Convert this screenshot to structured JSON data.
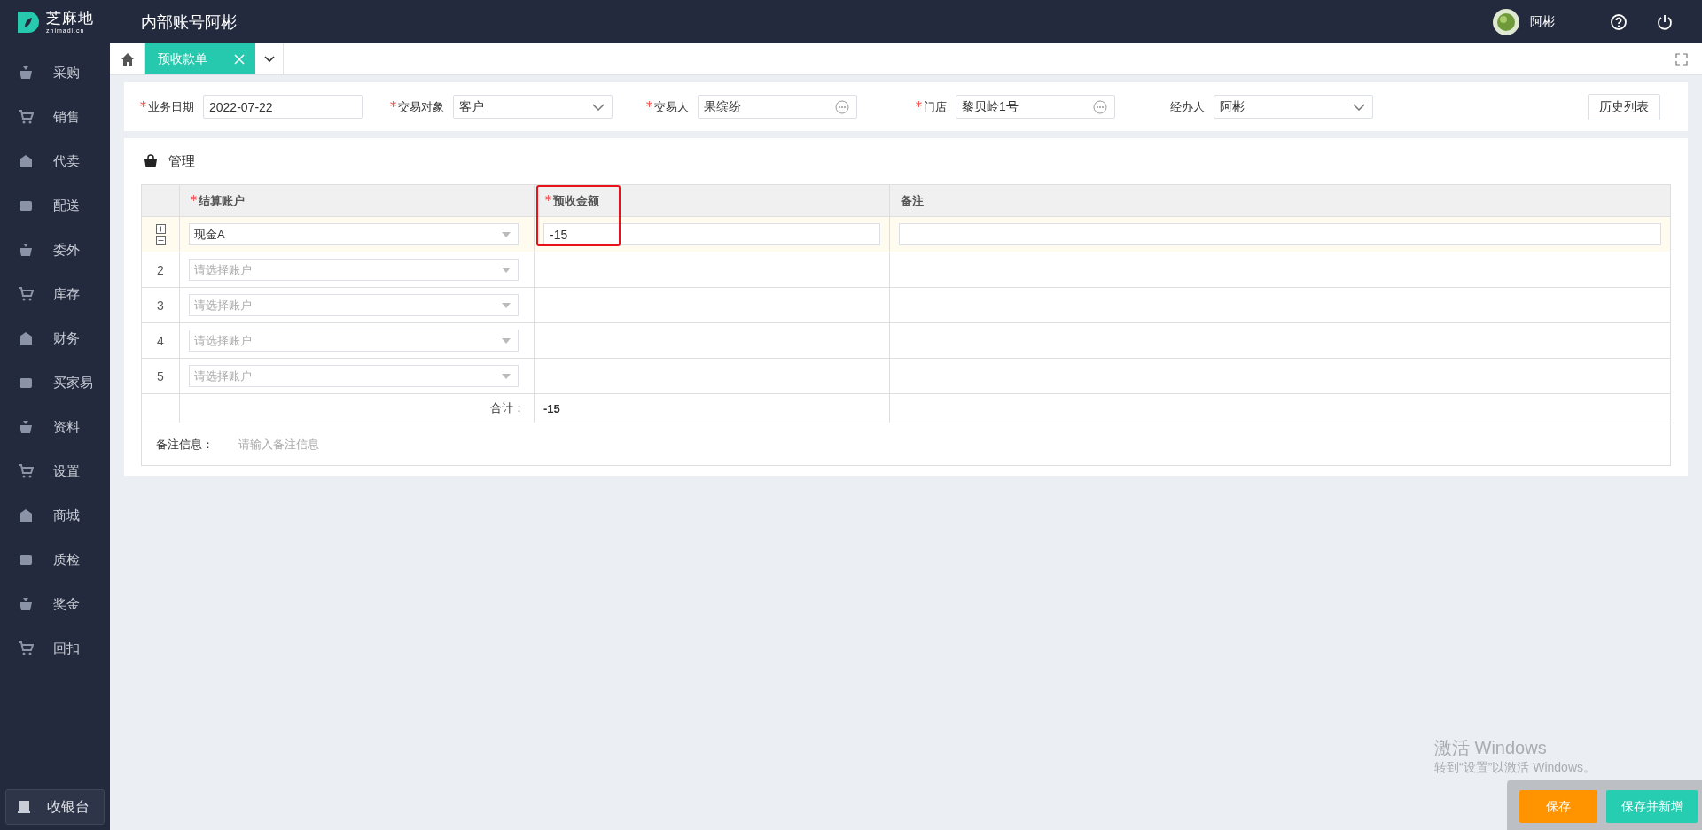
{
  "header": {
    "logo_text": "芝麻地",
    "logo_subtext": "zhimadi.cn",
    "account_title": "内部账号阿彬",
    "user_name": "阿彬"
  },
  "sidebar": {
    "items": [
      {
        "label": "采购"
      },
      {
        "label": "销售"
      },
      {
        "label": "代卖"
      },
      {
        "label": "配送"
      },
      {
        "label": "委外"
      },
      {
        "label": "库存"
      },
      {
        "label": "财务"
      },
      {
        "label": "买家易"
      },
      {
        "label": "资料"
      },
      {
        "label": "设置"
      },
      {
        "label": "商城"
      },
      {
        "label": "质检"
      },
      {
        "label": "奖金"
      },
      {
        "label": "回扣"
      }
    ],
    "cashier_button": "收银台"
  },
  "tabs": [
    {
      "label": "预收款单",
      "selected": true
    }
  ],
  "form": {
    "fields": [
      {
        "label": "业务日期",
        "required": true,
        "value": "2022-07-22",
        "kind": "text"
      },
      {
        "label": "交易对象",
        "required": true,
        "value": "客户",
        "kind": "select"
      },
      {
        "label": "交易人",
        "required": true,
        "value": "果缤纷",
        "kind": "picker"
      },
      {
        "label": "门店",
        "required": true,
        "value": "黎贝岭1号",
        "kind": "picker"
      },
      {
        "label": "经办人",
        "required": false,
        "value": "阿彬",
        "kind": "select"
      }
    ],
    "history_button": "历史列表"
  },
  "section": {
    "title": "管理"
  },
  "table": {
    "columns": [
      {
        "label": "结算账户",
        "required": true,
        "highlighted": false
      },
      {
        "label": "预收金额",
        "required": true,
        "highlighted": true
      },
      {
        "label": "备注",
        "required": false,
        "highlighted": false
      }
    ],
    "rows": [
      {
        "active": true,
        "account": "现金A",
        "amount": "-15"
      },
      {
        "active": false,
        "index": "2",
        "account_placeholder": "请选择账户"
      },
      {
        "active": false,
        "index": "3",
        "account_placeholder": "请选择账户"
      },
      {
        "active": false,
        "index": "4",
        "account_placeholder": "请选择账户"
      },
      {
        "active": false,
        "index": "5",
        "account_placeholder": "请选择账户"
      }
    ],
    "totals": {
      "label": "合计：",
      "amount": "-15"
    }
  },
  "remark_info": {
    "label": "备注信息：",
    "placeholder": "请输入备注信息"
  },
  "footer_buttons": [
    {
      "label": "保存",
      "kind": "primary"
    },
    {
      "label": "保存并新增",
      "kind": "secondary"
    }
  ],
  "os_notice": {
    "title": "激活 Windows",
    "subtitle": "转到“设置”以激活 Windows。"
  }
}
